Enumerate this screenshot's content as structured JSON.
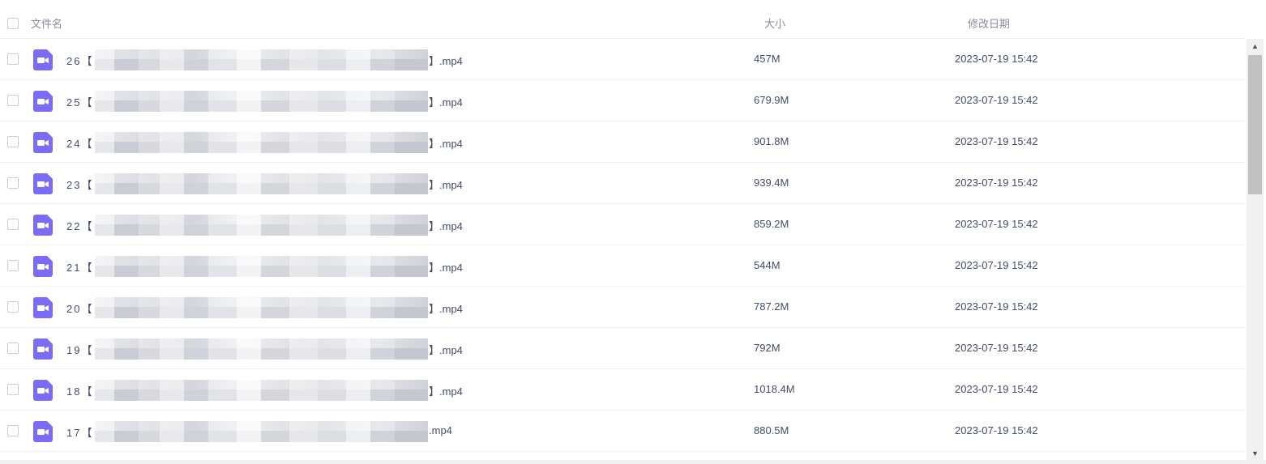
{
  "header": {
    "name_label": "文件名",
    "size_label": "大小",
    "date_label": "修改日期"
  },
  "colors": {
    "icon_accent": "#7B6CF6",
    "text_primary": "#424E67",
    "text_header": "#878C9C"
  },
  "files": [
    {
      "prefix": "26【",
      "ext": "】.mp4",
      "size": "457M",
      "date": "2023-07-19 15:42",
      "icon": "video-file-icon"
    },
    {
      "prefix": "25【",
      "ext": "】.mp4",
      "size": "679.9M",
      "date": "2023-07-19 15:42",
      "icon": "video-file-icon"
    },
    {
      "prefix": "24【",
      "ext": "】.mp4",
      "size": "901.8M",
      "date": "2023-07-19 15:42",
      "icon": "video-file-icon"
    },
    {
      "prefix": "23【",
      "ext": "】.mp4",
      "size": "939.4M",
      "date": "2023-07-19 15:42",
      "icon": "video-file-icon"
    },
    {
      "prefix": "22【",
      "ext": "】.mp4",
      "size": "859.2M",
      "date": "2023-07-19 15:42",
      "icon": "video-file-icon"
    },
    {
      "prefix": "21【",
      "ext": "】.mp4",
      "size": "544M",
      "date": "2023-07-19 15:42",
      "icon": "video-file-icon"
    },
    {
      "prefix": "20【",
      "ext": "】.mp4",
      "size": "787.2M",
      "date": "2023-07-19 15:42",
      "icon": "video-file-icon"
    },
    {
      "prefix": "19【",
      "ext": "】.mp4",
      "size": "792M",
      "date": "2023-07-19 15:42",
      "icon": "video-file-icon"
    },
    {
      "prefix": "18【",
      "ext": "】.mp4",
      "size": "1018.4M",
      "date": "2023-07-19 15:42",
      "icon": "video-file-icon"
    },
    {
      "prefix": "17【",
      "ext": ".mp4",
      "size": "880.5M",
      "date": "2023-07-19 15:42",
      "icon": "video-file-icon"
    }
  ],
  "scrollbar": {
    "up_arrow": "▲",
    "down_arrow": "▼"
  }
}
